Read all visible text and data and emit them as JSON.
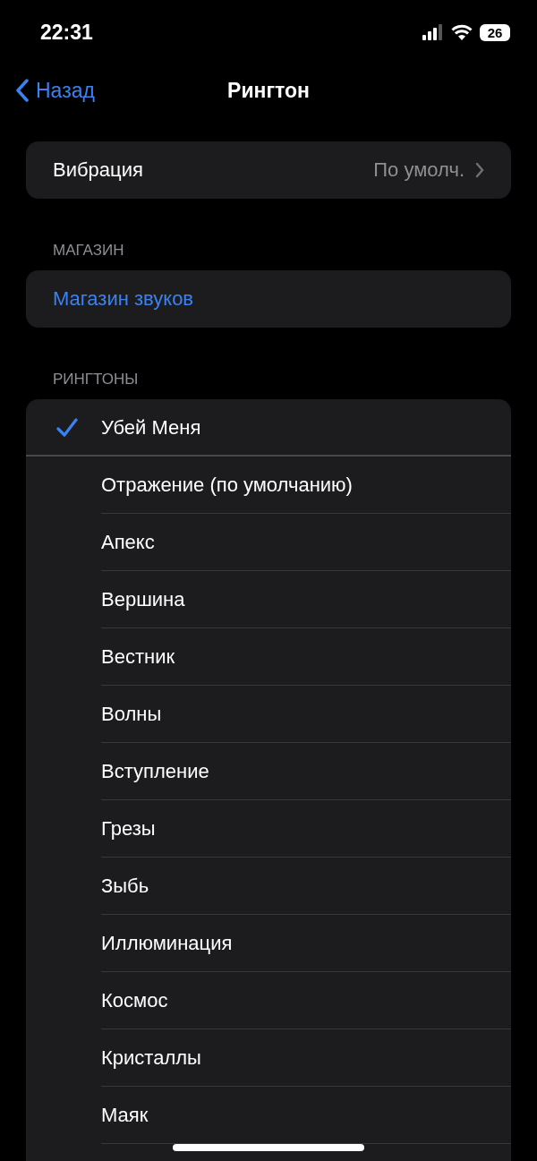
{
  "status_bar": {
    "time": "22:31",
    "battery": "26"
  },
  "nav": {
    "back": "Назад",
    "title": "Рингтон"
  },
  "vibration": {
    "label": "Вибрация",
    "value": "По умолч."
  },
  "store_section": {
    "header": "МАГАЗИН",
    "link": "Магазин звуков"
  },
  "ringtones_section": {
    "header": "РИНГТОНЫ",
    "items": [
      {
        "label": "Убей Меня",
        "selected": true
      },
      {
        "label": "Отражение (по умолчанию)",
        "selected": false
      },
      {
        "label": "Апекс",
        "selected": false
      },
      {
        "label": "Вершина",
        "selected": false
      },
      {
        "label": "Вестник",
        "selected": false
      },
      {
        "label": "Волны",
        "selected": false
      },
      {
        "label": "Вступление",
        "selected": false
      },
      {
        "label": "Грезы",
        "selected": false
      },
      {
        "label": "Зыбь",
        "selected": false
      },
      {
        "label": "Иллюминация",
        "selected": false
      },
      {
        "label": "Космос",
        "selected": false
      },
      {
        "label": "Кристаллы",
        "selected": false
      },
      {
        "label": "Маяк",
        "selected": false
      }
    ]
  }
}
